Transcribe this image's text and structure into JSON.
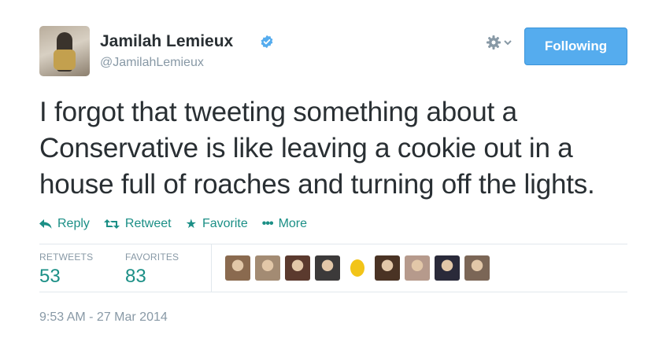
{
  "user": {
    "name": "Jamilah Lemieux",
    "handle": "@JamilahLemieux",
    "verified": true
  },
  "header": {
    "gear_icon": "gear-icon",
    "follow_button_label": "Following"
  },
  "tweet": {
    "lines": [
      "I forgot that tweeting something about a",
      "Conservative is like leaving a cookie out in a",
      "house full of roaches and turning off the lights."
    ]
  },
  "actions": [
    {
      "label": "Reply",
      "icon": "reply-icon"
    },
    {
      "label": "Retweet",
      "icon": "retweet-icon"
    },
    {
      "label": "Favorite",
      "icon": "star-icon"
    },
    {
      "label": "More",
      "icon": "more-icon"
    }
  ],
  "stats": {
    "retweets_label": "RETWEETS",
    "retweets_count": "53",
    "favorites_label": "FAVORITES",
    "favorites_count": "83"
  },
  "favoriter_avatars": [
    "#8a6a4f",
    "#a38b73",
    "#5b3a2e",
    "#3c3a3a",
    "#f2c418",
    "#4a3324",
    "#b69a8c",
    "#2a2a3a",
    "#7b6656"
  ],
  "timestamp": "9:53 AM - 27 Mar 2014",
  "colors": {
    "accent": "#55acee",
    "link": "#1b8f86",
    "muted": "#8899a6",
    "text": "#292f33"
  }
}
